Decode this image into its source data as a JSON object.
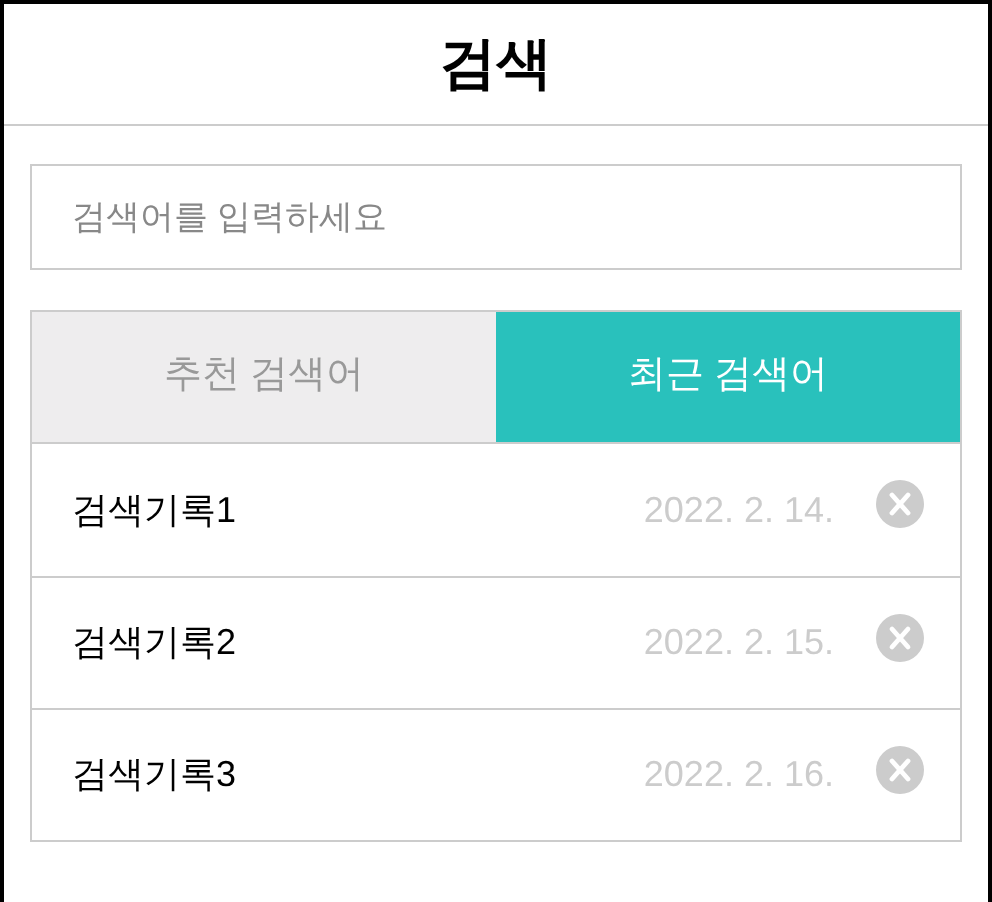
{
  "header": {
    "title": "검색"
  },
  "search": {
    "placeholder": "검색어를 입력하세요"
  },
  "tabs": [
    {
      "label": "추천 검색어",
      "selected": false
    },
    {
      "label": "최근 검색어",
      "selected": true
    }
  ],
  "history": [
    {
      "query": "검색기록1",
      "date": "2022. 2. 14."
    },
    {
      "query": "검색기록2",
      "date": "2022. 2. 15."
    },
    {
      "query": "검색기록3",
      "date": "2022. 2. 16."
    }
  ]
}
